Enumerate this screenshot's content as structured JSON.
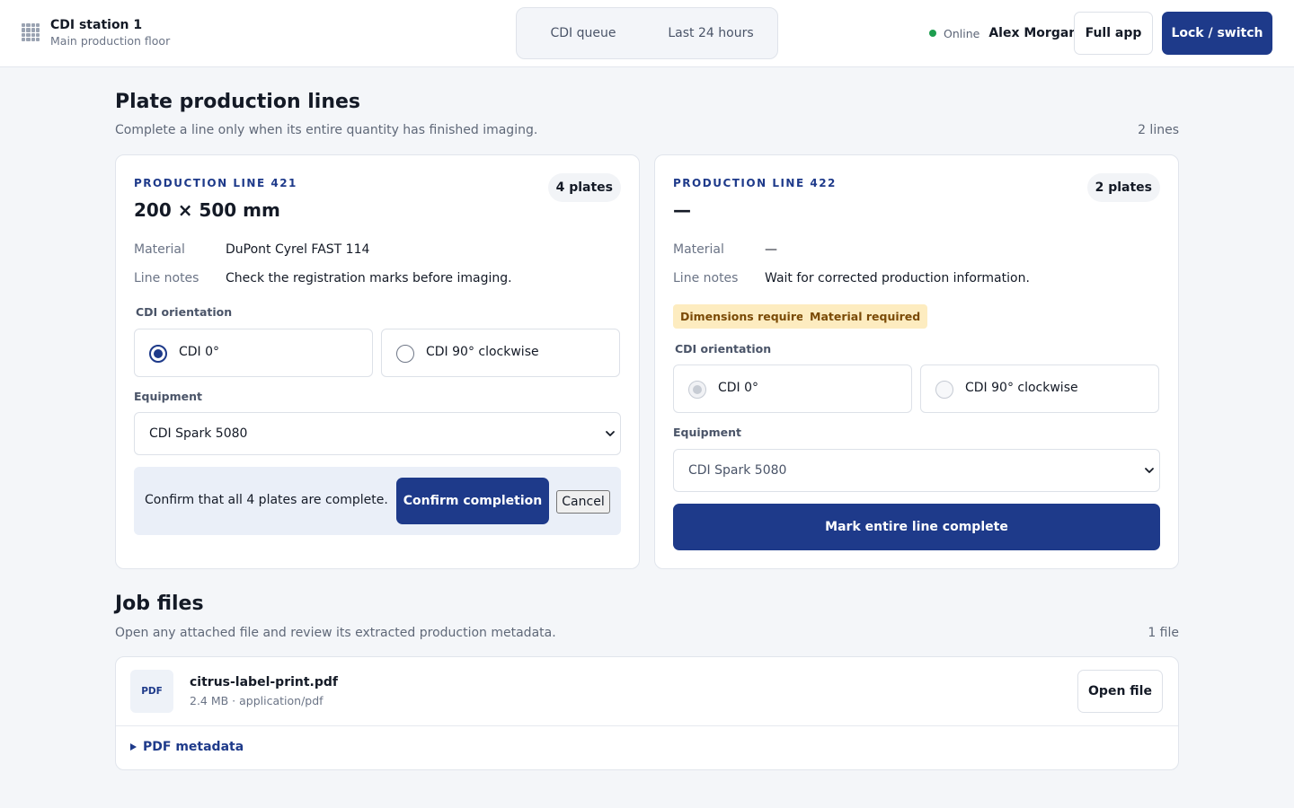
{
  "header": {
    "station_title": "CDI station 1",
    "station_subtitle": "Main production floor",
    "tabs": [
      {
        "label": "CDI queue"
      },
      {
        "label": "Last 24 hours"
      }
    ],
    "status": "Online",
    "user_name": "Alex Morgan",
    "full_app_label": "Full app",
    "lock_label": "Lock / switch"
  },
  "colors": {
    "primary": "#1e3a8a",
    "online": "#1e9e4f",
    "warning_bg": "#fdecc0",
    "warning_text": "#7a4a06"
  },
  "lines_section": {
    "title": "Plate production lines",
    "description": "Complete a line only when its entire quantity has finished imaging.",
    "count": "2 lines"
  },
  "lines": [
    {
      "eyebrow": "PRODUCTION LINE 421",
      "dimensions": "200 × 500 mm",
      "plates": "4 plates",
      "material_label": "Material",
      "material": "DuPont Cyrel FAST 114",
      "notes_label": "Line notes",
      "notes": "Check the registration marks before imaging.",
      "orientation_label": "CDI orientation",
      "orientation_options": [
        "CDI 0°",
        "CDI 90° clockwise"
      ],
      "orientation_selected": "CDI 0°",
      "equipment_label": "Equipment",
      "equipment": "CDI Spark 5080",
      "confirm_text": "Confirm that all 4 plates are complete.",
      "confirm_label": "Confirm completion",
      "cancel_label": "Cancel"
    },
    {
      "eyebrow": "PRODUCTION LINE 422",
      "dimensions": "—",
      "plates": "2 plates",
      "material_label": "Material",
      "material": "—",
      "notes_label": "Line notes",
      "notes": "Wait for corrected production information.",
      "tags": [
        "Dimensions required",
        "Material required"
      ],
      "orientation_label": "CDI orientation",
      "orientation_options": [
        "CDI 0°",
        "CDI 90° clockwise"
      ],
      "orientation_selected": "CDI 0°",
      "equipment_label": "Equipment",
      "equipment": "CDI Spark 5080",
      "action_label": "Mark entire line complete"
    }
  ],
  "files_section": {
    "title": "Job files",
    "description": "Open any attached file and review its extracted production metadata.",
    "count": "1 file"
  },
  "files": [
    {
      "type_badge": "PDF",
      "name": "citrus-label-print.pdf",
      "meta": "2.4 MB · application/pdf",
      "open_label": "Open file",
      "metadata_toggle": "PDF metadata"
    }
  ]
}
